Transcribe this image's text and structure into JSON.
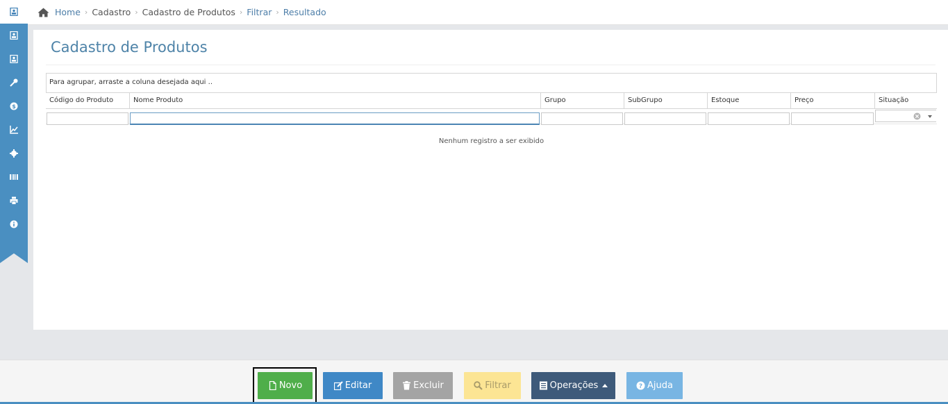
{
  "sidebar": {
    "items": [
      {
        "icon": "contact-book-icon",
        "active": true
      },
      {
        "icon": "contact-book-icon"
      },
      {
        "icon": "contact-book-icon"
      },
      {
        "icon": "key-icon"
      },
      {
        "icon": "dollar-icon"
      },
      {
        "icon": "line-chart-icon"
      },
      {
        "icon": "gear-icon"
      },
      {
        "icon": "barcode-icon"
      },
      {
        "icon": "printer-icon"
      },
      {
        "icon": "info-icon"
      }
    ]
  },
  "breadcrumb": {
    "home": "Home",
    "items": [
      "Cadastro",
      "Cadastro de Produtos",
      "Filtrar",
      "Resultado"
    ]
  },
  "page": {
    "title": "Cadastro de Produtos"
  },
  "grid": {
    "group_hint": "Para agrupar, arraste a coluna desejada aqui ..",
    "columns": [
      {
        "label": "Código do Produto"
      },
      {
        "label": "Nome Produto"
      },
      {
        "label": "Grupo"
      },
      {
        "label": "SubGrupo"
      },
      {
        "label": "Estoque"
      },
      {
        "label": "Preço"
      },
      {
        "label": "Situação"
      }
    ],
    "empty_message": "Nenhum registro a ser exibido"
  },
  "toolbar": {
    "novo": "Novo",
    "editar": "Editar",
    "excluir": "Excluir",
    "filtrar": "Filtrar",
    "operacoes": "Operações",
    "ajuda": "Ajuda"
  },
  "colors": {
    "sidebar": "#4a8fc1",
    "novo": "#4fae4a",
    "editar": "#3f88c6",
    "excluir": "#a4a4a4",
    "filtrar": "#fce594",
    "operacoes": "#3e5a7a",
    "ajuda": "#78b5e3"
  }
}
